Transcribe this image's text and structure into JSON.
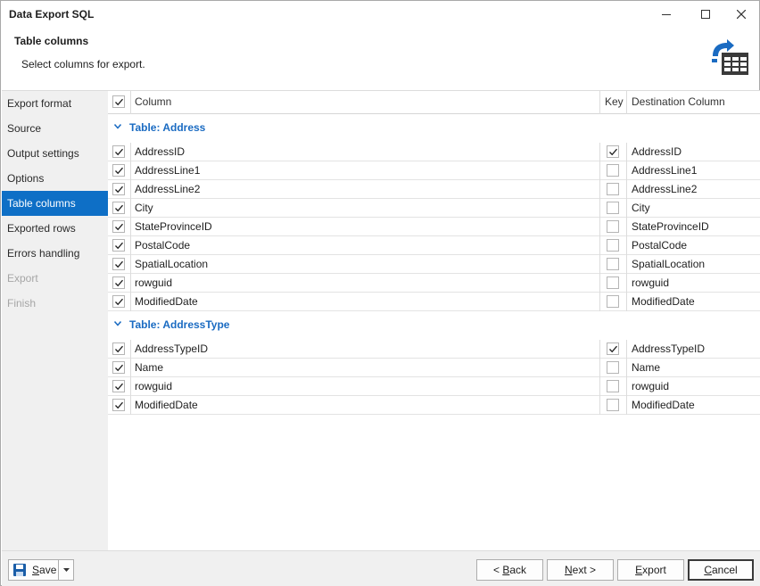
{
  "window": {
    "title": "Data Export SQL"
  },
  "header": {
    "title": "Table columns",
    "description": "Select columns for export."
  },
  "sidebar": {
    "items": [
      {
        "label": "Export format",
        "state": "normal"
      },
      {
        "label": "Source",
        "state": "normal"
      },
      {
        "label": "Output settings",
        "state": "normal"
      },
      {
        "label": "Options",
        "state": "normal"
      },
      {
        "label": "Table columns",
        "state": "active"
      },
      {
        "label": "Exported rows",
        "state": "normal"
      },
      {
        "label": "Errors handling",
        "state": "normal"
      },
      {
        "label": "Export",
        "state": "disabled"
      },
      {
        "label": "Finish",
        "state": "disabled"
      }
    ]
  },
  "grid": {
    "headers": {
      "column": "Column",
      "key": "Key",
      "destination": "Destination Column"
    },
    "select_all_checked": true,
    "groups": [
      {
        "label": "Table: Address",
        "rows": [
          {
            "column": "AddressID",
            "selected": true,
            "key": true,
            "destination": "AddressID"
          },
          {
            "column": "AddressLine1",
            "selected": true,
            "key": false,
            "destination": "AddressLine1"
          },
          {
            "column": "AddressLine2",
            "selected": true,
            "key": false,
            "destination": "AddressLine2"
          },
          {
            "column": "City",
            "selected": true,
            "key": false,
            "destination": "City"
          },
          {
            "column": "StateProvinceID",
            "selected": true,
            "key": false,
            "destination": "StateProvinceID"
          },
          {
            "column": "PostalCode",
            "selected": true,
            "key": false,
            "destination": "PostalCode"
          },
          {
            "column": "SpatialLocation",
            "selected": true,
            "key": false,
            "destination": "SpatialLocation"
          },
          {
            "column": "rowguid",
            "selected": true,
            "key": false,
            "destination": "rowguid"
          },
          {
            "column": "ModifiedDate",
            "selected": true,
            "key": false,
            "destination": "ModifiedDate"
          }
        ]
      },
      {
        "label": "Table: AddressType",
        "rows": [
          {
            "column": "AddressTypeID",
            "selected": true,
            "key": true,
            "destination": "AddressTypeID"
          },
          {
            "column": "Name",
            "selected": true,
            "key": false,
            "destination": "Name"
          },
          {
            "column": "rowguid",
            "selected": true,
            "key": false,
            "destination": "rowguid"
          },
          {
            "column": "ModifiedDate",
            "selected": true,
            "key": false,
            "destination": "ModifiedDate"
          }
        ]
      }
    ]
  },
  "footer": {
    "save": {
      "prefix": "",
      "mnemonic": "S",
      "rest": "ave"
    },
    "back": {
      "prefix": "< ",
      "mnemonic": "B",
      "rest": "ack"
    },
    "next": {
      "prefix": "",
      "mnemonic": "N",
      "rest": "ext >"
    },
    "export": {
      "prefix": "",
      "mnemonic": "E",
      "rest": "xport"
    },
    "cancel": {
      "prefix": "",
      "mnemonic": "C",
      "rest": "ancel"
    }
  },
  "colors": {
    "accent": "#0e6fc6",
    "group_label": "#1a6bc2",
    "sidebar_bg": "#f0f0f0"
  }
}
